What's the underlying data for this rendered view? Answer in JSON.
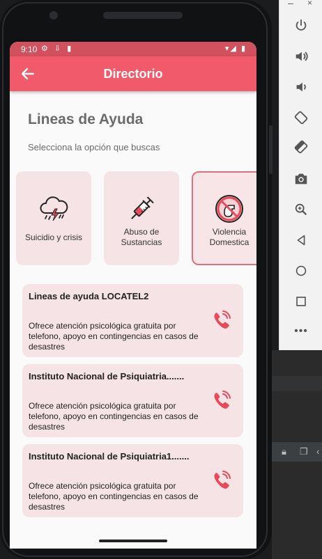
{
  "status_bar": {
    "time": "9:10",
    "left_icons": "⚙ ⇩ ▮",
    "right_icons": "▾◢ ▮"
  },
  "app_bar": {
    "title": "Directorio",
    "back_icon": "arrow-left-icon"
  },
  "page": {
    "title": "Lineas de Ayuda",
    "subtitle": "Selecciona la opción que buscas"
  },
  "categories": [
    {
      "label": "Suicidio y crisis",
      "icon": "storm-cloud-icon",
      "selected": false
    },
    {
      "label_line1": "Abuso de",
      "label_line2": "Sustancias",
      "icon": "syringe-icon",
      "selected": false
    },
    {
      "label_line1": "Violencia",
      "label_line2": "Domestica",
      "icon": "no-violence-icon",
      "selected": true
    }
  ],
  "help_lines": [
    {
      "title": "Lineas de ayuda LOCATEL2",
      "description": "Ofrece atención psicológica gratuita por telefono, apoyo en contingencias en casos de desastres",
      "icon": "phone-call-icon"
    },
    {
      "title": "Instituto Nacional de Psiquiatria.......",
      "description": "Ofrece atención psicológica gratuita por telefono, apoyo en contingencias en casos de desastres",
      "icon": "phone-call-icon"
    },
    {
      "title": "Instituto Nacional de Psiquiatria1.......",
      "description": "Ofrece atención psicológica gratuita por telefono, apoyo en contingencias en casos de desastres",
      "icon": "phone-call-icon"
    }
  ],
  "emulator_toolbar": {
    "minimize": "–",
    "close": "×",
    "buttons": [
      "power-icon",
      "volume-up-icon",
      "volume-down-icon",
      "rotate-left-icon",
      "rotate-right-icon",
      "camera-icon",
      "zoom-icon",
      "back-icon",
      "home-icon",
      "overview-icon"
    ],
    "more": "•••"
  },
  "colors": {
    "status_bar": "#d1515f",
    "app_bar": "#f05a6a",
    "card": "#f6e3e5",
    "accent": "#e0707b",
    "title_gray": "#6b6b6b"
  }
}
